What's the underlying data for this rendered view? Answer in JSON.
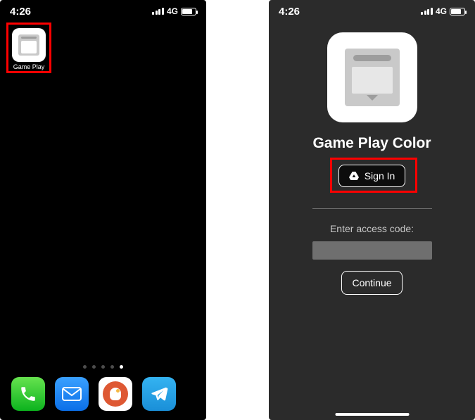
{
  "status": {
    "time": "4:26",
    "network": "4G"
  },
  "left": {
    "app_label": "Game Play",
    "dock": [
      "phone",
      "mail",
      "duckduckgo",
      "telegram"
    ]
  },
  "right": {
    "title": "Game Play Color",
    "sign_in_label": "Sign In",
    "access_label": "Enter access code:",
    "access_value": "",
    "access_placeholder": "",
    "continue_label": "Continue"
  }
}
